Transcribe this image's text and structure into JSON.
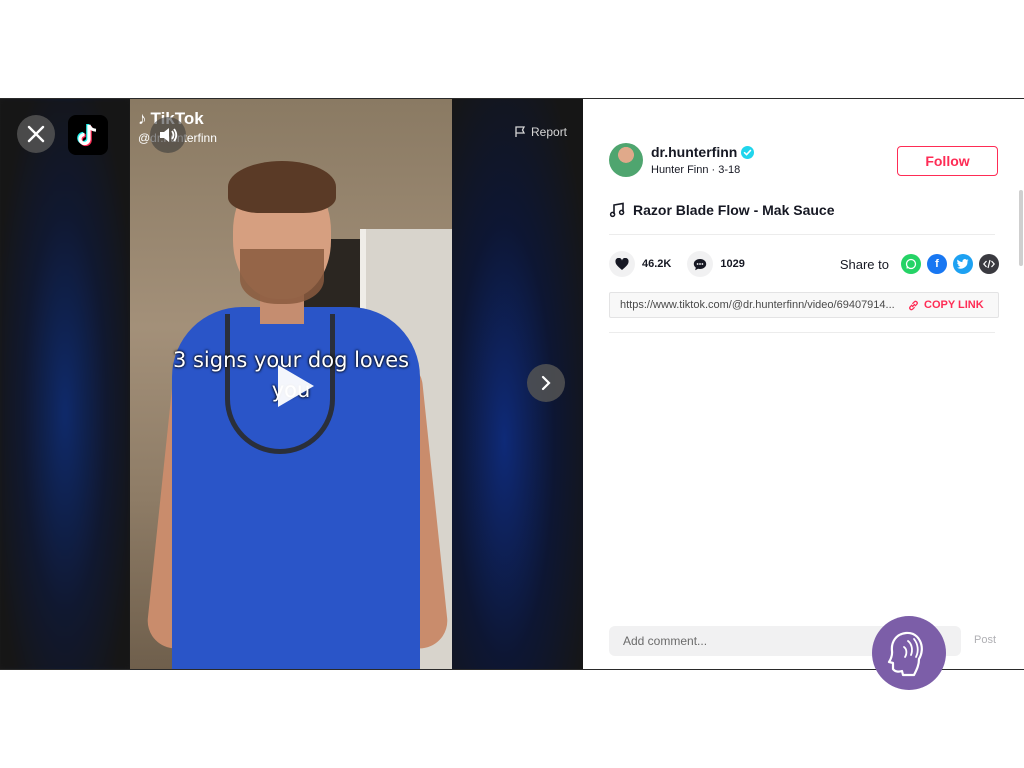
{
  "video": {
    "caption": "3 signs your dog loves you",
    "watermark_logo": "TikTok",
    "watermark_user": "@dr.hunterfinn",
    "report_label": "Report"
  },
  "author": {
    "username": "dr.hunterfinn",
    "subtitle": "Hunter Finn · 3-18",
    "follow_label": "Follow"
  },
  "music": {
    "title": "Razor Blade Flow - Mak Sauce"
  },
  "stats": {
    "likes": "46.2K",
    "comments": "1029"
  },
  "share": {
    "label": "Share to",
    "targets": [
      "whatsapp-icon",
      "facebook-icon",
      "twitter-icon",
      "embed-icon"
    ]
  },
  "link": {
    "url": "https://www.tiktok.com/@dr.hunterfinn/video/69407914...",
    "copy_label": "COPY LINK"
  },
  "comment": {
    "placeholder": "Add comment...",
    "post_label": "Post"
  },
  "colors": {
    "accent": "#fe2c55",
    "verified": "#20d5ec",
    "assistant_badge": "#7c5ea8"
  }
}
